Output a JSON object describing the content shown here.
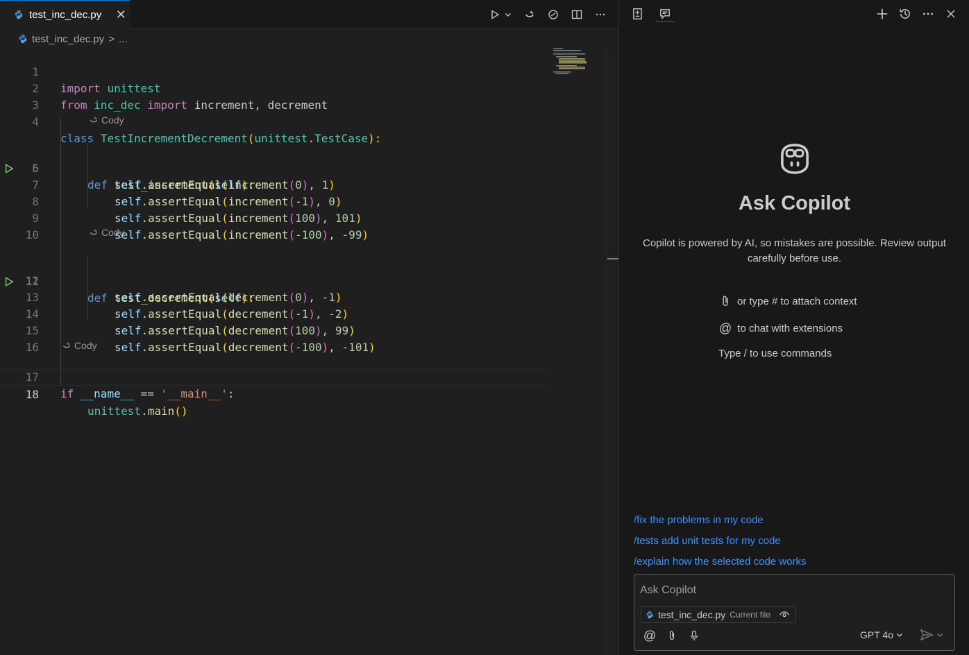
{
  "editor": {
    "tab": {
      "filename": "test_inc_dec.py",
      "close_glyph": "✕"
    },
    "actions": [
      "run-icon",
      "chevron-down-icon",
      "cody-icon",
      "copilot-icon",
      "split-editor-icon",
      "more-icon"
    ],
    "breadcrumb": {
      "file": "test_inc_dec.py",
      "separator": ">",
      "more": "..."
    },
    "line_numbers": [
      "1",
      "2",
      "3",
      "4",
      "5",
      "6",
      "7",
      "8",
      "9",
      "10",
      "11",
      "12",
      "13",
      "14",
      "15",
      "16",
      "17",
      "18"
    ],
    "codelens_label": "Cody",
    "code": {
      "l1": {
        "kw": "import",
        "mod": "unittest"
      },
      "l2": {
        "kw1": "from",
        "mod": "inc_dec",
        "kw2": "import",
        "names": "increment, decrement"
      },
      "l4": {
        "kw": "class",
        "cls": "TestIncrementDecrement",
        "open": "(",
        "mod": "unittest",
        "dot": ".",
        "base": "TestCase",
        "close": "):"
      },
      "l5": {
        "kw": "def",
        "fn": "test_increment",
        "open": "(",
        "self": "self",
        "close": "):"
      },
      "l6": {
        "self": "self",
        "call": ".assertEqual",
        "p": "(",
        "fn": "increment",
        "ip": "(",
        "arg": "0",
        "ipc": ")",
        "sep": ", ",
        "exp": "1",
        "pc": ")"
      },
      "l7": {
        "self": "self",
        "call": ".assertEqual",
        "p": "(",
        "fn": "increment",
        "ip": "(",
        "arg": "-1",
        "ipc": ")",
        "sep": ", ",
        "exp": "0",
        "pc": ")"
      },
      "l8": {
        "self": "self",
        "call": ".assertEqual",
        "p": "(",
        "fn": "increment",
        "ip": "(",
        "arg": "100",
        "ipc": ")",
        "sep": ", ",
        "exp": "101",
        "pc": ")"
      },
      "l9": {
        "self": "self",
        "call": ".assertEqual",
        "p": "(",
        "fn": "increment",
        "ip": "(",
        "arg": "-100",
        "ipc": ")",
        "sep": ", ",
        "exp": "-99",
        "pc": ")"
      },
      "l11": {
        "kw": "def",
        "fn": "test_decrement",
        "open": "(",
        "self": "self",
        "close": "):"
      },
      "l12": {
        "self": "self",
        "call": ".assertEqual",
        "p": "(",
        "fn": "decrement",
        "ip": "(",
        "arg": "0",
        "ipc": ")",
        "sep": ", ",
        "exp": "-1",
        "pc": ")"
      },
      "l13": {
        "self": "self",
        "call": ".assertEqual",
        "p": "(",
        "fn": "decrement",
        "ip": "(",
        "arg": "-1",
        "ipc": ")",
        "sep": ", ",
        "exp": "-2",
        "pc": ")"
      },
      "l14": {
        "self": "self",
        "call": ".assertEqual",
        "p": "(",
        "fn": "decrement",
        "ip": "(",
        "arg": "100",
        "ipc": ")",
        "sep": ", ",
        "exp": "99",
        "pc": ")"
      },
      "l15": {
        "self": "self",
        "call": ".assertEqual",
        "p": "(",
        "fn": "decrement",
        "ip": "(",
        "arg": "-100",
        "ipc": ")",
        "sep": ", ",
        "exp": "-101",
        "pc": ")"
      },
      "l17": {
        "kw": "if",
        "var": "__name__",
        "op": " == ",
        "str": "'__main__'",
        "colon": ":"
      },
      "l18": {
        "mod": "unittest",
        "dot": ".",
        "fn": "main",
        "p": "()"
      }
    }
  },
  "copilot": {
    "header_icons": [
      "new-chat-icon",
      "history-icon",
      "more-icon",
      "close-icon"
    ],
    "title": "Ask Copilot",
    "description": "Copilot is powered by AI, so mistakes are possible. Review output carefully before use.",
    "hints": {
      "attach": "or type # to attach context",
      "at": "@",
      "extensions": "to chat with extensions",
      "commands": "Type / to use commands"
    },
    "suggestions": [
      "/fix the problems in my code",
      "/tests add unit tests for my code",
      "/explain how the selected code works"
    ],
    "input": {
      "placeholder": "Ask Copilot",
      "chip_file": "test_inc_dec.py",
      "chip_sub": "Current file",
      "at_label": "@",
      "model": "GPT 4o"
    }
  },
  "colors": {
    "accent": "#0078d4",
    "link": "#3794ff",
    "run_green": "#89d185"
  }
}
